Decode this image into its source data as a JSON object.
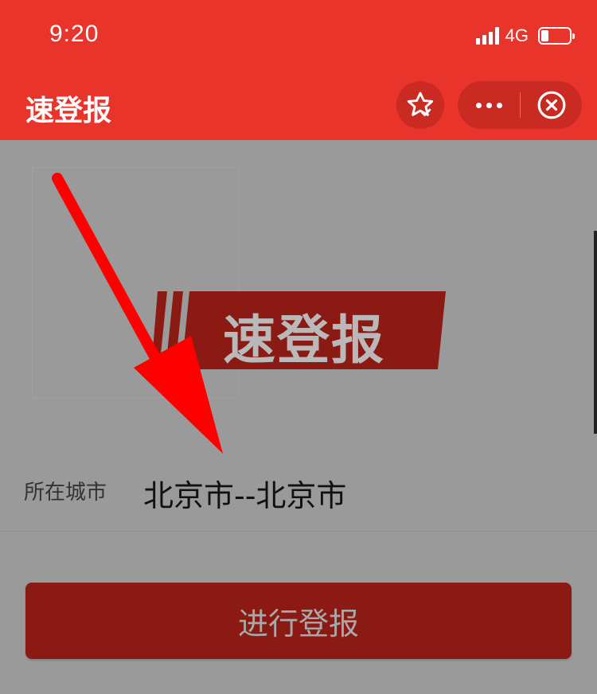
{
  "status_bar": {
    "time": "9:20",
    "network": "4G",
    "battery_level": 0.25
  },
  "nav": {
    "title": "速登报",
    "favorite_icon": "star-check-icon",
    "more_icon": "more-dots-icon",
    "close_icon": "close-circle-icon"
  },
  "banner": {
    "text": "速登报"
  },
  "form": {
    "city_label": "所在城市",
    "city_value": "北京市--北京市"
  },
  "submit": {
    "label": "进行登报"
  },
  "colors": {
    "header": "#e8342b",
    "button": "#8b1a14",
    "arrow": "#ff0000"
  }
}
